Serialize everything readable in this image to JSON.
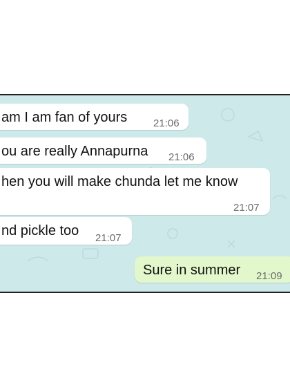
{
  "chat": {
    "wallpaper_color": "#cde9e9",
    "outgoing_color": "#e2f7cb",
    "incoming_color": "#ffffff",
    "messages": [
      {
        "direction": "incoming",
        "text": "am I am fan of yours",
        "time": "21:06"
      },
      {
        "direction": "incoming",
        "text": "ou are really Annapurna",
        "time": "21:06"
      },
      {
        "direction": "incoming",
        "text": "hen you will make chunda let me know",
        "time": "21:07"
      },
      {
        "direction": "incoming",
        "text": "nd pickle too",
        "time": "21:07"
      },
      {
        "direction": "outgoing",
        "text": "Sure in summer",
        "time": "21:09"
      }
    ]
  }
}
